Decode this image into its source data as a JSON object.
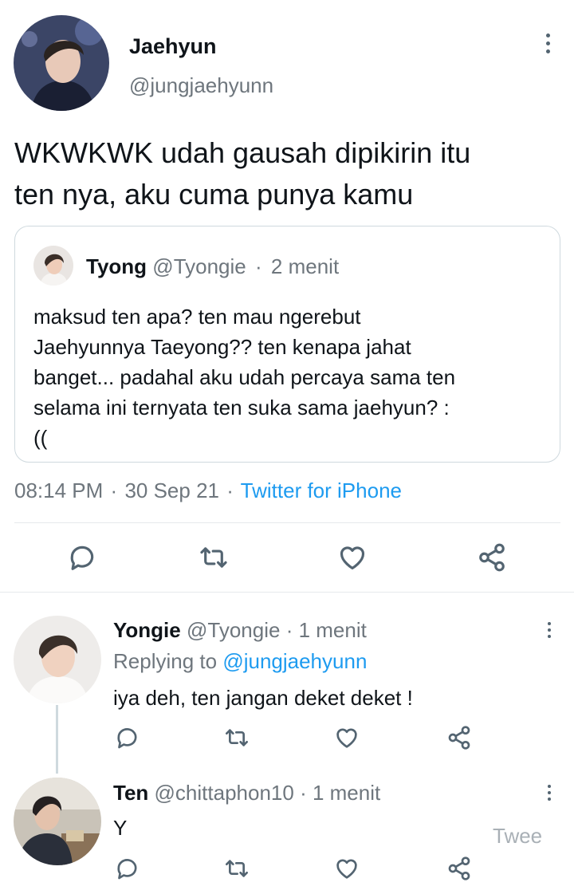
{
  "main_tweet": {
    "author_name": "Jaehyun",
    "author_handle": "@jungjaehyunn",
    "text_line1": "WKWKWK udah gausah dipikirin itu",
    "text_line2": "ten nya, aku cuma punya kamu",
    "quoted": {
      "author_name": "Tyong",
      "author_handle": "@Tyongie",
      "separator": "·",
      "time": "2 menit",
      "text_lines": [
        "maksud ten apa? ten mau ngerebut",
        "Jaehyunnya Taeyong?? ten kenapa jahat",
        "banget... padahal aku udah percaya sama ten",
        "selama ini ternyata ten suka sama jaehyun? :",
        "(("
      ]
    },
    "time": "08:14 PM",
    "dot1": "·",
    "date": "30 Sep 21",
    "dot2": "·",
    "source": "Twitter for iPhone"
  },
  "replies": [
    {
      "author_name": "Yongie",
      "author_handle": "@Tyongie",
      "separator": "·",
      "time": "1 menit",
      "replying_prefix": "Replying to",
      "replying_handle": "@jungjaehyunn",
      "text": "iya deh, ten jangan deket deket !"
    },
    {
      "author_name": "Ten",
      "author_handle": "@chittaphon10",
      "separator": "·",
      "time": "1 menit",
      "text": "Y",
      "overlay_text": "Twee"
    }
  ],
  "icons": {
    "reply": "reply-icon",
    "retweet": "retweet-icon",
    "like": "heart-icon",
    "share": "share-icon",
    "more": "more-icon"
  },
  "colors": {
    "link": "#1d9bf0",
    "secondary_text": "#6e767d",
    "icon": "#536471",
    "divider": "#e6e9ec"
  }
}
